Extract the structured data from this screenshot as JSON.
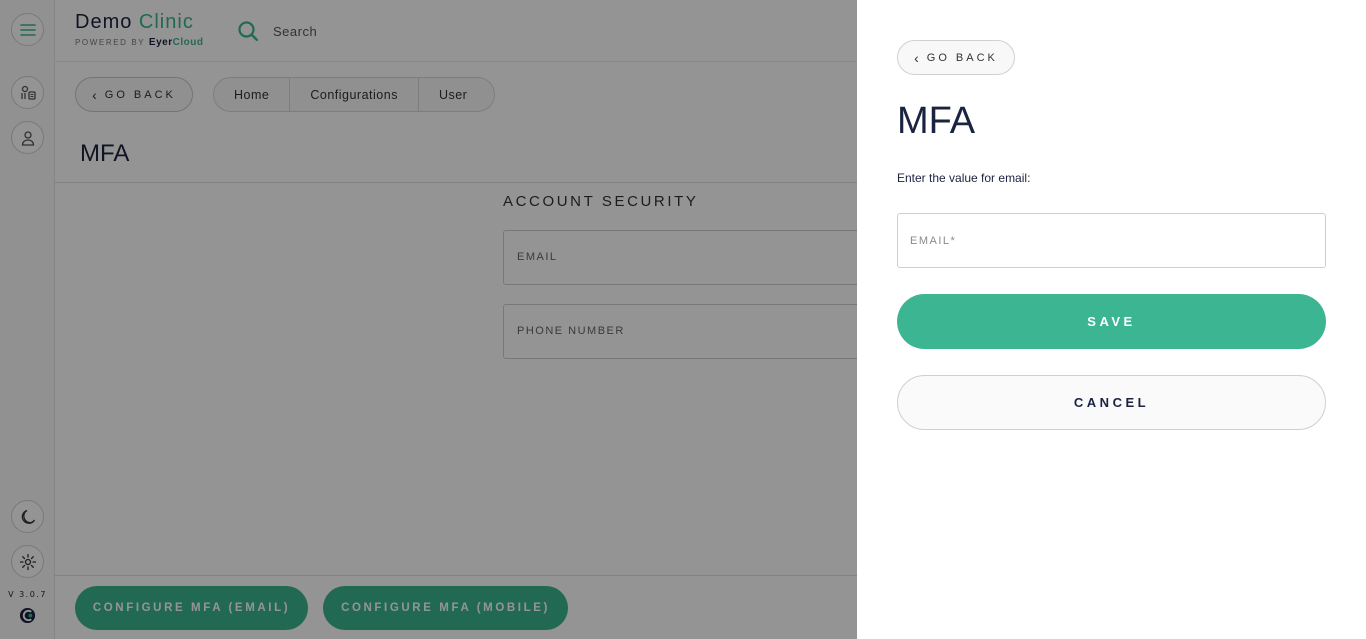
{
  "app": {
    "brand_main": "Demo",
    "brand_accent": "Clinic",
    "powered_by": "POWERED BY",
    "powered_brand_1": "Eyer",
    "powered_brand_2": "Cloud",
    "search_placeholder": "Search",
    "version": "V 3.0.7"
  },
  "sidebar": {
    "icons": [
      "menu-icon",
      "patients-icon",
      "user-icon",
      "moon-icon",
      "gear-icon",
      "app-logo-icon"
    ]
  },
  "page": {
    "go_back": "GO BACK",
    "breadcrumbs": [
      "Home",
      "Configurations",
      "User"
    ],
    "title": "MFA",
    "section_title": "ACCOUNT SECURITY",
    "email_label": "EMAIL",
    "phone_label": "PHONE NUMBER",
    "configure_email": "CONFIGURE MFA (EMAIL)",
    "configure_mobile": "CONFIGURE MFA (MOBILE)"
  },
  "drawer": {
    "go_back": "GO BACK",
    "title": "MFA",
    "prompt": "Enter the value for email:",
    "email_placeholder": "EMAIL*",
    "email_value": "",
    "save": "SAVE",
    "cancel": "CANCEL"
  },
  "colors": {
    "accent": "#3cb592",
    "text_dark": "#1a2340",
    "overlay": "rgba(0,0,0,0.42)"
  }
}
